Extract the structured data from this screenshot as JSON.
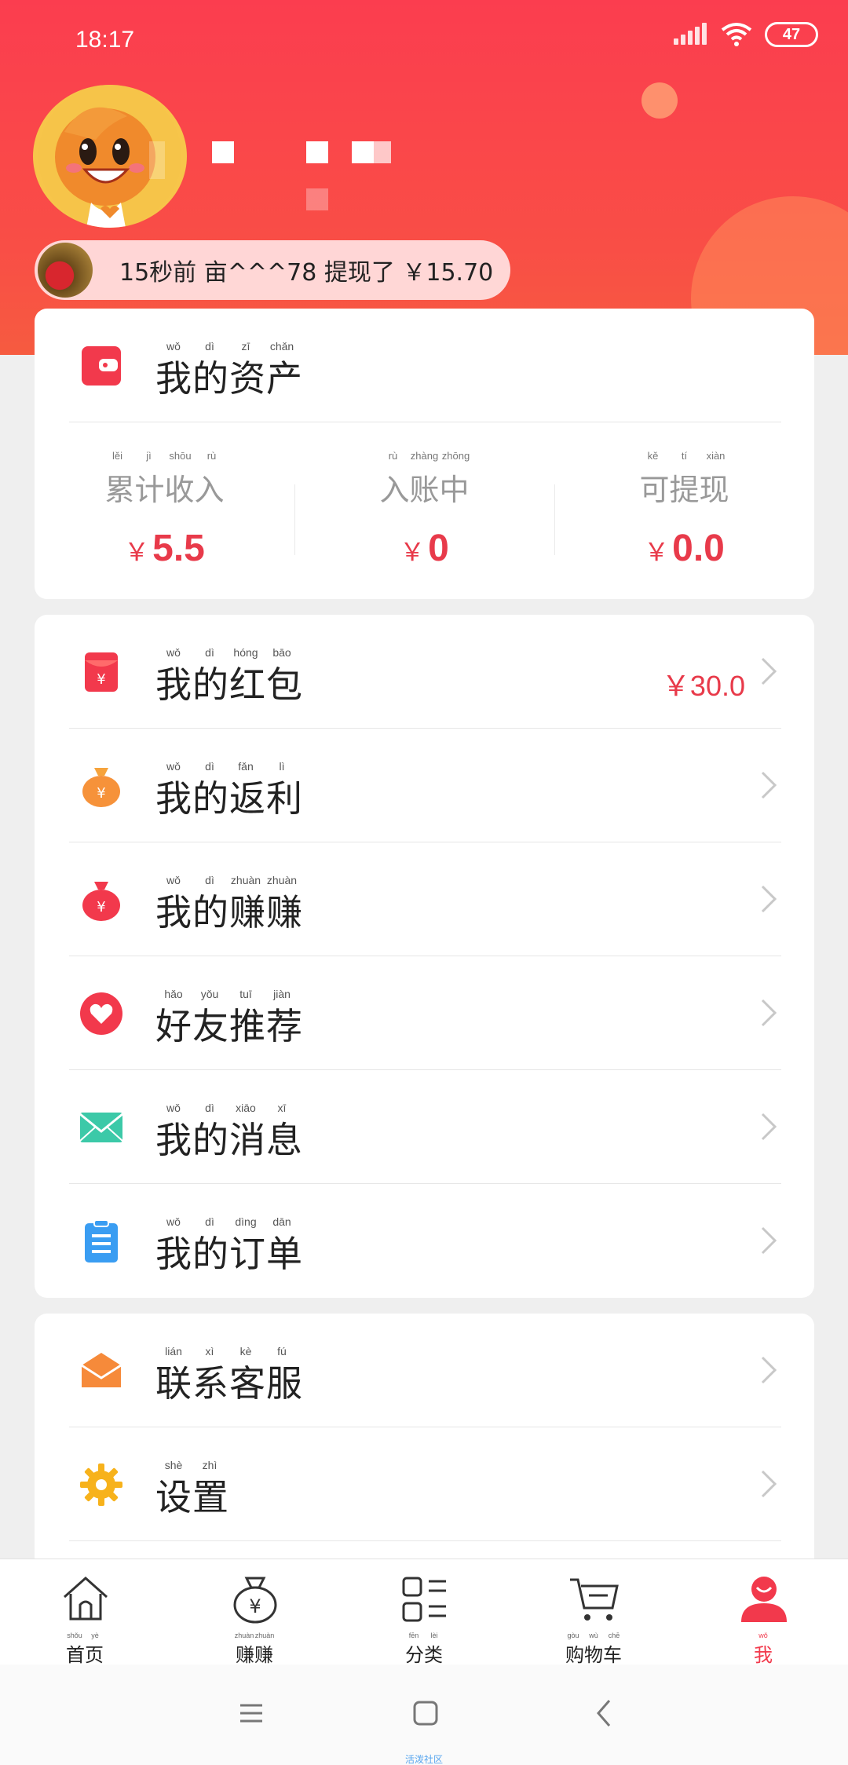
{
  "status_bar": {
    "time": "18:17",
    "battery": "47"
  },
  "ticker": {
    "text": "15秒前 亩^^^78 提现了 ￥15.70"
  },
  "assets": {
    "title": "我的资产",
    "title_pinyin": [
      "wǒ",
      "dì",
      "zī",
      "chǎn"
    ],
    "stats": [
      {
        "label": "累计收入",
        "pinyin": [
          "lěi",
          "jì",
          "shōu",
          "rù"
        ],
        "currency": "￥",
        "value": "5.5"
      },
      {
        "label": "入账中",
        "pinyin": [
          "rù",
          "zhàng",
          "zhōng"
        ],
        "currency": "￥",
        "value": "0"
      },
      {
        "label": "可提现",
        "pinyin": [
          "kě",
          "tí",
          "xiàn"
        ],
        "currency": "￥",
        "value": "0.0"
      }
    ]
  },
  "menu1": [
    {
      "label": "我的红包",
      "pinyin": [
        "wǒ",
        "dì",
        "hóng",
        "bāo"
      ],
      "icon": "red-envelope-icon",
      "value": "￥30.0"
    },
    {
      "label": "我的返利",
      "pinyin": [
        "wǒ",
        "dì",
        "fǎn",
        "lì"
      ],
      "icon": "money-bag-icon"
    },
    {
      "label": "我的赚赚",
      "pinyin": [
        "wǒ",
        "dì",
        "zhuàn",
        "zhuàn"
      ],
      "icon": "red-money-bag-icon"
    },
    {
      "label": "好友推荐",
      "pinyin": [
        "hǎo",
        "yǒu",
        "tuī",
        "jiàn"
      ],
      "icon": "heart-icon"
    },
    {
      "label": "我的消息",
      "pinyin": [
        "wǒ",
        "dì",
        "xiāo",
        "xī"
      ],
      "icon": "envelope-icon"
    },
    {
      "label": "我的订单",
      "pinyin": [
        "wǒ",
        "dì",
        "dìng",
        "dān"
      ],
      "icon": "clipboard-icon"
    }
  ],
  "menu2": [
    {
      "label": "联系客服",
      "pinyin": [
        "lián",
        "xì",
        "kè",
        "fú"
      ],
      "icon": "open-envelope-icon"
    },
    {
      "label": "设置",
      "pinyin": [
        "shè",
        "zhì"
      ],
      "icon": "gear-icon"
    }
  ],
  "bottom_nav": [
    {
      "label": "首页",
      "pinyin": [
        "shǒu",
        "yè"
      ],
      "icon": "home-icon"
    },
    {
      "label": "赚赚",
      "pinyin": [
        "zhuàn",
        "zhuàn"
      ],
      "icon": "money-bag-outline-icon"
    },
    {
      "label": "分类",
      "pinyin": [
        "fēn",
        "lèi"
      ],
      "icon": "category-icon"
    },
    {
      "label": "购物车",
      "pinyin": [
        "gòu",
        "wù",
        "chē"
      ],
      "icon": "cart-icon"
    },
    {
      "label": "我",
      "pinyin": [
        "wǒ"
      ],
      "icon": "user-icon",
      "active": true
    }
  ],
  "watermark": "活泼社区",
  "colors": {
    "accent": "#f2394c",
    "header": "#fb3d4f"
  }
}
